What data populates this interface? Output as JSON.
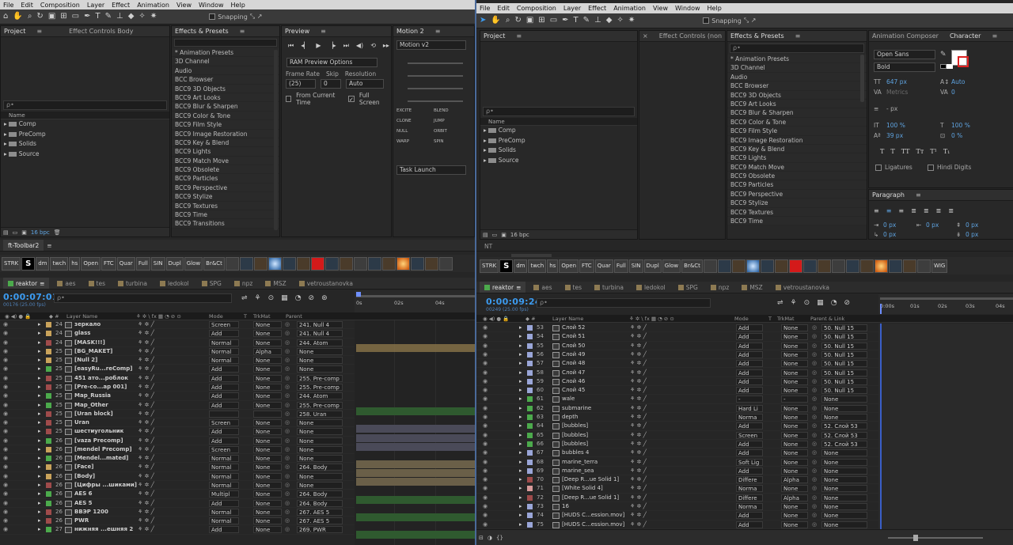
{
  "menu": [
    "File",
    "Edit",
    "Composition",
    "Layer",
    "Effect",
    "Animation",
    "View",
    "Window",
    "Help"
  ],
  "snapping": "Snapping",
  "left": {
    "project_tab": "Project",
    "effect_controls_tab": "Effect Controls Body",
    "effects_tab": "Effects & Presets",
    "preview_tab": "Preview",
    "motion_tab": "Motion 2",
    "project_search": "ρ•",
    "name_col": "Name",
    "bpc": "16 bpc",
    "effects": [
      "* Animation Presets",
      "3D Channel",
      "Audio",
      "BCC Browser",
      "BCC9 3D Objects",
      "BCC9 Art Looks",
      "BCC9 Blur & Sharpen",
      "BCC9 Color & Tone",
      "BCC9 Film Style",
      "BCC9 Image Restoration",
      "BCC9 Key & Blend",
      "BCC9 Lights",
      "BCC9 Match Move",
      "BCC9 Obsolete",
      "BCC9 Particles",
      "BCC9 Perspective",
      "BCC9 Stylize",
      "BCC9 Textures",
      "BCC9 Time",
      "BCC9 Transitions"
    ],
    "preview": {
      "ram": "RAM Preview Options",
      "framerate": "Frame Rate",
      "skip": "Skip",
      "resolution": "Resolution",
      "fr_val": "(25)",
      "skip_val": "0",
      "res_val": "Auto",
      "from_current": "From Current Time",
      "full_screen": "Full Screen"
    },
    "motion": {
      "select": "Motion v2",
      "buttons": [
        "EXCITE",
        "BLEND",
        "CLONE",
        "JUMP",
        "NULL",
        "ORBIT",
        "WARP",
        "SPIN"
      ],
      "task": "Task Launch"
    },
    "toolbar_tab": "ft-Toolbar2",
    "tl_tabs": [
      "reaktor",
      "aes",
      "tes",
      "turbina",
      "ledokol",
      "SPG",
      "npz",
      "MSZ",
      "vetroustanovka"
    ],
    "timecode": "0:00:07:01",
    "timecode_sub": "00176 (25.00 fps)",
    "ruler": [
      "0s",
      "02s",
      "04s"
    ],
    "col_layer": "Layer Name",
    "col_mode": "Mode",
    "col_t": "T",
    "col_trk": "TrkMat",
    "col_parent": "Parent",
    "rows": [
      {
        "n": "24",
        "c": "#c9a35b",
        "name": "зеркало",
        "mode": "Screen",
        "trk": "None",
        "parent": "241. Null 4"
      },
      {
        "n": "24",
        "c": "#c9a35b",
        "name": "glass",
        "mode": "Add",
        "trk": "None",
        "parent": "241. Null 4"
      },
      {
        "n": "24",
        "c": "#9f4b4b",
        "name": "[MASK!!!]",
        "mode": "Normal",
        "trk": "None",
        "parent": "244. Atom"
      },
      {
        "n": "25",
        "c": "#c9a35b",
        "name": "[BG_MAKET]",
        "mode": "Normal",
        "trk": "Alpha",
        "parent": "None"
      },
      {
        "n": "25",
        "c": "#c9a35b",
        "name": "[Null 2]",
        "mode": "Normal",
        "trk": "None",
        "parent": "None"
      },
      {
        "n": "25",
        "c": "#4caa4c",
        "name": "[easyRu...reComp]",
        "mode": "Add",
        "trk": "None",
        "parent": "None"
      },
      {
        "n": "25",
        "c": "#9f4b4b",
        "name": "451 ато...роблок",
        "mode": "Add",
        "trk": "None",
        "parent": "255. Pre-comp"
      },
      {
        "n": "25",
        "c": "#9f4b4b",
        "name": "[Pre-co...ap 001]",
        "mode": "Add",
        "trk": "None",
        "parent": "255. Pre-comp"
      },
      {
        "n": "25",
        "c": "#4caa4c",
        "name": "Map_Russia",
        "mode": "Add",
        "trk": "None",
        "parent": "244. Atom"
      },
      {
        "n": "25",
        "c": "#4caa4c",
        "name": "Map_Other",
        "mode": "Add",
        "trk": "None",
        "parent": "255. Pre-comp"
      },
      {
        "n": "25",
        "c": "#9f4b4b",
        "name": "[Uran block]",
        "mode": "",
        "trk": "",
        "parent": "258. Uran"
      },
      {
        "n": "25",
        "c": "#9f4b4b",
        "name": "Uran",
        "mode": "Screen",
        "trk": "None",
        "parent": "None"
      },
      {
        "n": "25",
        "c": "#9f4b4b",
        "name": "шестиугольник",
        "mode": "Add",
        "trk": "None",
        "parent": "None"
      },
      {
        "n": "26",
        "c": "#4caa4c",
        "name": "[vaza Precomp]",
        "mode": "Add",
        "trk": "None",
        "parent": "None"
      },
      {
        "n": "26",
        "c": "#c9a35b",
        "name": "[mendel Precomp]",
        "mode": "Screen",
        "trk": "None",
        "parent": "None"
      },
      {
        "n": "26",
        "c": "#4caa4c",
        "name": "[Mendel...mated]",
        "mode": "Normal",
        "trk": "None",
        "parent": "None"
      },
      {
        "n": "26",
        "c": "#c9a35b",
        "name": "[Face]",
        "mode": "Normal",
        "trk": "None",
        "parent": "264. Body"
      },
      {
        "n": "26",
        "c": "#c9a35b",
        "name": "[Body]",
        "mode": "Normal",
        "trk": "None",
        "parent": "None"
      },
      {
        "n": "26",
        "c": "#9f4b4b",
        "name": "[Цифры ...шиками]",
        "mode": "Normal",
        "trk": "None",
        "parent": "None"
      },
      {
        "n": "26",
        "c": "#4caa4c",
        "name": "AES 6",
        "mode": "Multipl",
        "trk": "None",
        "parent": "264. Body"
      },
      {
        "n": "26",
        "c": "#4caa4c",
        "name": "AES 5",
        "mode": "Add",
        "trk": "None",
        "parent": "264. Body"
      },
      {
        "n": "26",
        "c": "#9f4b4b",
        "name": "BBЭP 1200",
        "mode": "Normal",
        "trk": "None",
        "parent": "267. AES 5"
      },
      {
        "n": "26",
        "c": "#9f4b4b",
        "name": "PWR",
        "mode": "Normal",
        "trk": "None",
        "parent": "267. AES 5"
      },
      {
        "n": "27",
        "c": "#4caa4c",
        "name": "нижняя ...ешняя 2",
        "mode": "Add",
        "trk": "None",
        "parent": "269. PWR"
      }
    ]
  },
  "right": {
    "project_tab": "Project",
    "effect_controls_tab": "Effect Controls (non",
    "effects_tab": "Effects & Presets",
    "anim_tab": "Animation Composer",
    "char_tab": "Character",
    "name_col": "Name",
    "project_items": [
      "Comp",
      "PreComp",
      "Solids",
      "Source"
    ],
    "bpc": "16 bpc",
    "effects": [
      "* Animation Presets",
      "3D Channel",
      "Audio",
      "BCC Browser",
      "BCC9 3D Objects",
      "BCC9 Art Looks",
      "BCC9 Blur & Sharpen",
      "BCC9 Color & Tone",
      "BCC9 Film Style",
      "BCC9 Image Restoration",
      "BCC9 Key & Blend",
      "BCC9 Lights",
      "BCC9 Match Move",
      "BCC9 Obsolete",
      "BCC9 Particles",
      "BCC9 Perspective",
      "BCC9 Stylize",
      "BCC9 Textures",
      "BCC9 Time"
    ],
    "character": {
      "font": "Open Sans",
      "style": "Bold",
      "size": "647 px",
      "leading": "Auto",
      "kerning": "Metrics",
      "tracking": "0",
      "px": "- px",
      "vscale": "100 %",
      "hscale": "100 %",
      "baseline": "39 px",
      "tsume": "0 %",
      "ligatures": "Ligatures",
      "hindi": "Hindi Digits"
    },
    "paragraph_tab": "Paragraph",
    "para": [
      "0 px",
      "0 px",
      "0 px",
      "0 px",
      "0 px"
    ],
    "nt": "NT",
    "toolbar_tab": "ft-Toolbar2",
    "tl_tabs": [
      "reaktor",
      "aes",
      "tes",
      "turbina",
      "ledokol",
      "SPG",
      "npz",
      "MSZ",
      "vetroustanovka"
    ],
    "timecode": "0:00:09:24",
    "timecode_sub": "00249 (25.00 fps)",
    "ruler": [
      "0:00s",
      "01s",
      "02s",
      "03s",
      "04s"
    ],
    "col_layer": "Layer Name",
    "col_mode": "Mode",
    "col_t": "T",
    "col_trk": "TrkMat",
    "col_parent": "Parent & Link",
    "rows": [
      {
        "n": "53",
        "c": "#9aa6d8",
        "name": "Слой 52",
        "mode": "Add",
        "trk": "None",
        "parent": "50. Null 15"
      },
      {
        "n": "54",
        "c": "#9aa6d8",
        "name": "Слой 51",
        "mode": "Add",
        "trk": "None",
        "parent": "50. Null 15"
      },
      {
        "n": "55",
        "c": "#9aa6d8",
        "name": "Слой 50",
        "mode": "Add",
        "trk": "None",
        "parent": "50. Null 15"
      },
      {
        "n": "56",
        "c": "#9aa6d8",
        "name": "Слой 49",
        "mode": "Add",
        "trk": "None",
        "parent": "50. Null 15"
      },
      {
        "n": "57",
        "c": "#9aa6d8",
        "name": "Слой 48",
        "mode": "Add",
        "trk": "None",
        "parent": "50. Null 15"
      },
      {
        "n": "58",
        "c": "#9aa6d8",
        "name": "Слой 47",
        "mode": "Add",
        "trk": "None",
        "parent": "50. Null 15"
      },
      {
        "n": "59",
        "c": "#9aa6d8",
        "name": "Слой 46",
        "mode": "Add",
        "trk": "None",
        "parent": "50. Null 15"
      },
      {
        "n": "60",
        "c": "#9aa6d8",
        "name": "Слой 45",
        "mode": "Add",
        "trk": "None",
        "parent": "50. Null 15"
      },
      {
        "n": "61",
        "c": "#4caa4c",
        "name": "wale",
        "mode": "-",
        "trk": "-",
        "parent": "None"
      },
      {
        "n": "62",
        "c": "#4caa4c",
        "name": "submarine",
        "mode": "Hard Li",
        "trk": "None",
        "parent": "None"
      },
      {
        "n": "63",
        "c": "#4caa4c",
        "name": "depth",
        "mode": "Norma",
        "trk": "None",
        "parent": "None"
      },
      {
        "n": "64",
        "c": "#4caa4c",
        "name": "[bubbles]",
        "mode": "Add",
        "trk": "None",
        "parent": "52. Слой 53"
      },
      {
        "n": "65",
        "c": "#4caa4c",
        "name": "[bubbles]",
        "mode": "Screen",
        "trk": "None",
        "parent": "52. Слой 53"
      },
      {
        "n": "66",
        "c": "#4caa4c",
        "name": "[bubbles]",
        "mode": "Add",
        "trk": "None",
        "parent": "52. Слой 53"
      },
      {
        "n": "67",
        "c": "#9aa6d8",
        "name": "bubbles 4",
        "mode": "Add",
        "trk": "None",
        "parent": "None"
      },
      {
        "n": "68",
        "c": "#9aa6d8",
        "name": "marine_terra",
        "mode": "Soft Lig",
        "trk": "None",
        "parent": "None"
      },
      {
        "n": "69",
        "c": "#9aa6d8",
        "name": "marine_sea",
        "mode": "Add",
        "trk": "None",
        "parent": "None"
      },
      {
        "n": "70",
        "c": "#9f4b4b",
        "name": "[Deep R...ue Solid 1]",
        "mode": "Differe",
        "trk": "Alpha",
        "parent": "None"
      },
      {
        "n": "71",
        "c": "#d89a9a",
        "name": "[White Solid 4]",
        "mode": "Norma",
        "trk": "None",
        "parent": "None"
      },
      {
        "n": "72",
        "c": "#9f4b4b",
        "name": "[Deep R...ue Solid 1]",
        "mode": "Differe",
        "trk": "Alpha",
        "parent": "None"
      },
      {
        "n": "73",
        "c": "#9aa6d8",
        "name": "16",
        "mode": "Norma",
        "trk": "None",
        "parent": "None"
      },
      {
        "n": "74",
        "c": "#9aa6d8",
        "name": "[HUDS C...ession.mov]",
        "mode": "Add",
        "trk": "None",
        "parent": "None"
      },
      {
        "n": "75",
        "c": "#9aa6d8",
        "name": "[HUDS C...ession.mov]",
        "mode": "Add",
        "trk": "None",
        "parent": "None"
      }
    ]
  },
  "ft_buttons": [
    "STRK",
    "S",
    "dm",
    "twch",
    "hs",
    "Open",
    "FTC",
    "Quar",
    "Full",
    "SIN",
    "Dupl",
    "Glow",
    "Br&Ct"
  ],
  "ft_buttons_right_extra": "WIG"
}
